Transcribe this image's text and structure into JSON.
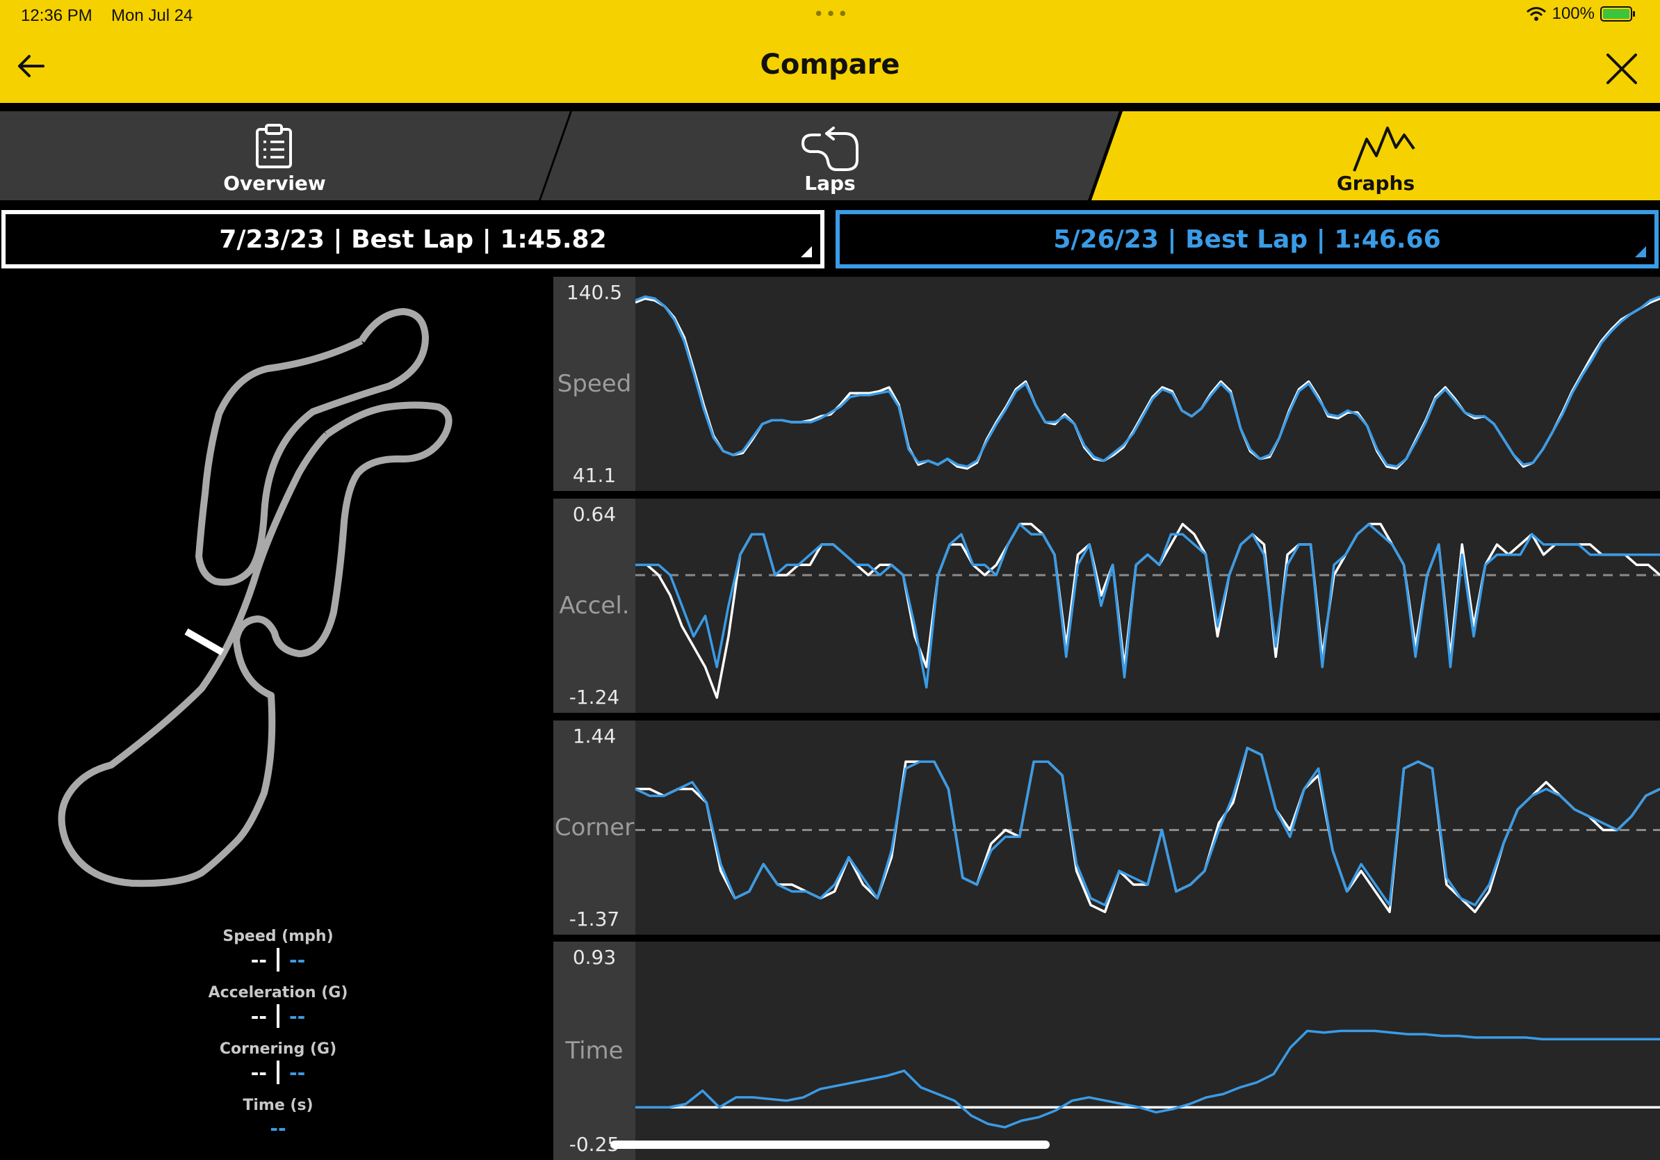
{
  "status_bar": {
    "time": "12:36 PM",
    "date": "Mon Jul 24",
    "dots": "•••",
    "battery": "100%"
  },
  "header": {
    "title": "Compare",
    "back_icon": "arrow-left-icon",
    "close_icon": "close-icon"
  },
  "tabs": [
    {
      "label": "Overview",
      "icon": "clipboard-icon",
      "active": false
    },
    {
      "label": "Laps",
      "icon": "lap-loop-icon",
      "active": false
    },
    {
      "label": "Graphs",
      "icon": "graph-zigzag-icon",
      "active": true
    }
  ],
  "lap_a": {
    "label": "7/23/23 | Best Lap | 1:45.82",
    "color": "#ffffff"
  },
  "lap_b": {
    "label": "5/26/23 | Best Lap | 1:46.66",
    "color": "#3a9be6"
  },
  "readouts": [
    {
      "label": "Speed (mph)",
      "a": "--",
      "b": "--"
    },
    {
      "label": "Acceleration (G)",
      "a": "--",
      "b": "--"
    },
    {
      "label": "Cornering (G)",
      "a": "--",
      "b": "--"
    },
    {
      "label": "Time (s)",
      "b": "--"
    }
  ],
  "chart_data": [
    {
      "type": "line",
      "name": "Speed",
      "max_label": "140.5",
      "min_label": "41.1",
      "ylim": [
        41.1,
        140.5
      ],
      "series": [
        {
          "values": [
            133,
            135,
            134,
            131,
            125,
            115,
            98,
            80,
            64,
            56,
            54,
            55,
            62,
            70,
            72,
            72,
            71,
            71,
            72,
            74,
            75,
            80,
            86,
            86,
            86,
            87,
            89,
            80,
            58,
            49,
            51,
            49,
            52,
            48,
            47,
            50,
            62,
            71,
            79,
            88,
            92,
            80,
            71,
            70,
            75,
            70,
            58,
            52,
            51,
            54,
            58,
            66,
            75,
            84,
            89,
            87,
            77,
            74,
            78,
            86,
            92,
            87,
            68,
            56,
            52,
            53,
            63,
            77,
            88,
            92,
            84,
            74,
            73,
            76,
            76,
            69,
            56,
            48,
            47,
            52,
            62,
            72,
            84,
            89,
            83,
            76,
            73,
            74,
            70,
            62,
            54,
            48,
            50,
            57,
            66,
            76,
            87,
            96,
            105,
            113,
            119,
            124,
            127,
            130,
            133,
            135
          ]
        },
        {
          "values": [
            134,
            136,
            135,
            131,
            124,
            113,
            96,
            78,
            63,
            56,
            54,
            56,
            63,
            70,
            72,
            72,
            71,
            71,
            71,
            73,
            76,
            79,
            84,
            85,
            85,
            86,
            87,
            79,
            57,
            50,
            51,
            49,
            52,
            49,
            48,
            51,
            61,
            70,
            78,
            87,
            91,
            80,
            71,
            71,
            74,
            70,
            59,
            53,
            51,
            55,
            59,
            65,
            74,
            83,
            88,
            86,
            77,
            74,
            78,
            85,
            91,
            86,
            68,
            57,
            52,
            54,
            63,
            76,
            87,
            91,
            83,
            75,
            74,
            77,
            75,
            69,
            57,
            49,
            48,
            52,
            61,
            71,
            83,
            88,
            82,
            76,
            74,
            74,
            70,
            62,
            54,
            49,
            50,
            57,
            66,
            75,
            86,
            95,
            103,
            112,
            118,
            123,
            127,
            130,
            134,
            136
          ]
        }
      ]
    },
    {
      "type": "line",
      "name": "Accel.",
      "max_label": "0.64",
      "min_label": "-1.24",
      "ylim": [
        -1.24,
        0.64
      ],
      "reference_line": 0,
      "series": [
        {
          "values": [
            0.1,
            0.1,
            0.0,
            -0.2,
            -0.5,
            -0.7,
            -0.9,
            -1.2,
            -0.6,
            0.2,
            0.4,
            0.4,
            0.0,
            0.0,
            0.1,
            0.1,
            0.3,
            0.3,
            0.2,
            0.1,
            0.0,
            0.1,
            0.1,
            0.0,
            -0.6,
            -0.9,
            0.0,
            0.3,
            0.3,
            0.1,
            0.0,
            0.1,
            0.3,
            0.5,
            0.5,
            0.4,
            0.2,
            -0.7,
            0.2,
            0.3,
            -0.2,
            0.1,
            -0.9,
            0.1,
            0.2,
            0.1,
            0.3,
            0.5,
            0.4,
            0.2,
            -0.6,
            0.0,
            0.3,
            0.4,
            0.3,
            -0.8,
            0.2,
            0.3,
            0.3,
            -0.8,
            0.0,
            0.2,
            0.4,
            0.5,
            0.5,
            0.3,
            0.1,
            -0.7,
            0.0,
            0.3,
            -0.8,
            0.3,
            -0.5,
            0.1,
            0.3,
            0.2,
            0.3,
            0.4,
            0.2,
            0.3,
            0.3,
            0.3,
            0.3,
            0.2,
            0.2,
            0.2,
            0.1,
            0.1,
            0.0
          ]
        },
        {
          "values": [
            0.1,
            0.1,
            0.1,
            0.0,
            -0.3,
            -0.6,
            -0.4,
            -0.9,
            -0.3,
            0.2,
            0.4,
            0.4,
            0.0,
            0.1,
            0.1,
            0.2,
            0.3,
            0.3,
            0.2,
            0.1,
            0.1,
            0.0,
            0.1,
            0.0,
            -0.5,
            -1.1,
            0.0,
            0.3,
            0.4,
            0.1,
            0.1,
            0.0,
            0.3,
            0.5,
            0.4,
            0.4,
            0.2,
            -0.8,
            0.1,
            0.3,
            -0.3,
            0.1,
            -1.0,
            0.1,
            0.2,
            0.1,
            0.4,
            0.4,
            0.3,
            0.2,
            -0.5,
            0.0,
            0.3,
            0.4,
            0.2,
            -0.7,
            0.1,
            0.3,
            0.3,
            -0.9,
            0.1,
            0.2,
            0.4,
            0.5,
            0.4,
            0.3,
            0.1,
            -0.8,
            0.0,
            0.3,
            -0.9,
            0.2,
            -0.6,
            0.1,
            0.2,
            0.2,
            0.2,
            0.4,
            0.3,
            0.3,
            0.3,
            0.3,
            0.2,
            0.2,
            0.2,
            0.2,
            0.2,
            0.2,
            0.2
          ]
        }
      ]
    },
    {
      "type": "line",
      "name": "Corner",
      "max_label": "1.44",
      "min_label": "-1.37",
      "ylim": [
        -1.37,
        1.44
      ],
      "reference_line": 0,
      "series": [
        {
          "values": [
            0.6,
            0.6,
            0.5,
            0.6,
            0.6,
            0.4,
            -0.6,
            -1.0,
            -0.9,
            -0.5,
            -0.8,
            -0.8,
            -0.9,
            -1.0,
            -0.9,
            -0.4,
            -0.8,
            -1.0,
            -0.4,
            1.0,
            1.0,
            1.0,
            0.6,
            -0.7,
            -0.8,
            -0.2,
            0.0,
            -0.1,
            1.0,
            1.0,
            0.8,
            -0.6,
            -1.1,
            -1.2,
            -0.6,
            -0.8,
            -0.8,
            0.0,
            -0.9,
            -0.8,
            -0.6,
            0.1,
            0.4,
            1.2,
            1.1,
            0.3,
            0.0,
            0.6,
            0.8,
            -0.3,
            -0.9,
            -0.6,
            -0.9,
            -1.2,
            0.9,
            1.0,
            0.9,
            -0.8,
            -1.0,
            -1.2,
            -0.9,
            -0.2,
            0.3,
            0.5,
            0.7,
            0.5,
            0.3,
            0.2,
            0.0,
            0.0,
            0.2,
            0.5,
            0.6
          ]
        },
        {
          "values": [
            0.6,
            0.5,
            0.5,
            0.6,
            0.7,
            0.4,
            -0.5,
            -1.0,
            -0.9,
            -0.5,
            -0.8,
            -0.9,
            -0.9,
            -1.0,
            -0.8,
            -0.4,
            -0.7,
            -1.0,
            -0.3,
            0.9,
            1.0,
            1.0,
            0.6,
            -0.7,
            -0.8,
            -0.3,
            -0.1,
            -0.1,
            1.0,
            1.0,
            0.8,
            -0.5,
            -1.0,
            -1.1,
            -0.6,
            -0.7,
            -0.8,
            0.0,
            -0.9,
            -0.8,
            -0.6,
            0.0,
            0.5,
            1.2,
            1.1,
            0.3,
            -0.1,
            0.6,
            0.9,
            -0.3,
            -0.9,
            -0.5,
            -0.8,
            -1.1,
            0.9,
            1.0,
            0.9,
            -0.7,
            -1.0,
            -1.1,
            -0.8,
            -0.2,
            0.3,
            0.5,
            0.6,
            0.5,
            0.3,
            0.2,
            0.1,
            0.0,
            0.2,
            0.5,
            0.6
          ]
        }
      ]
    },
    {
      "type": "line",
      "name": "Time",
      "max_label": "0.93",
      "min_label": "-0.25",
      "ylim": [
        -0.25,
        0.93
      ],
      "reference_line": 0,
      "series": [
        {
          "values": [
            0,
            0,
            0,
            0,
            0,
            0,
            0,
            0,
            0,
            0,
            0,
            0,
            0,
            0,
            0,
            0,
            0,
            0,
            0,
            0,
            0,
            0,
            0,
            0,
            0,
            0,
            0,
            0,
            0,
            0,
            0,
            0,
            0,
            0,
            0,
            0,
            0,
            0,
            0,
            0,
            0,
            0,
            0,
            0,
            0,
            0,
            0,
            0,
            0,
            0,
            0,
            0,
            0,
            0,
            0,
            0,
            0,
            0,
            0,
            0,
            0,
            0
          ]
        },
        {
          "values": [
            0.0,
            0.0,
            0.0,
            0.02,
            0.1,
            0.0,
            0.06,
            0.06,
            0.05,
            0.04,
            0.06,
            0.11,
            0.13,
            0.15,
            0.17,
            0.19,
            0.22,
            0.12,
            0.08,
            0.04,
            -0.05,
            -0.1,
            -0.12,
            -0.08,
            -0.06,
            -0.02,
            0.04,
            0.06,
            0.04,
            0.02,
            0.0,
            -0.03,
            -0.01,
            0.02,
            0.06,
            0.08,
            0.12,
            0.15,
            0.2,
            0.36,
            0.46,
            0.45,
            0.46,
            0.46,
            0.46,
            0.45,
            0.44,
            0.44,
            0.43,
            0.43,
            0.42,
            0.42,
            0.42,
            0.42,
            0.41,
            0.41,
            0.41,
            0.41,
            0.41,
            0.41,
            0.41,
            0.41
          ]
        }
      ]
    }
  ]
}
